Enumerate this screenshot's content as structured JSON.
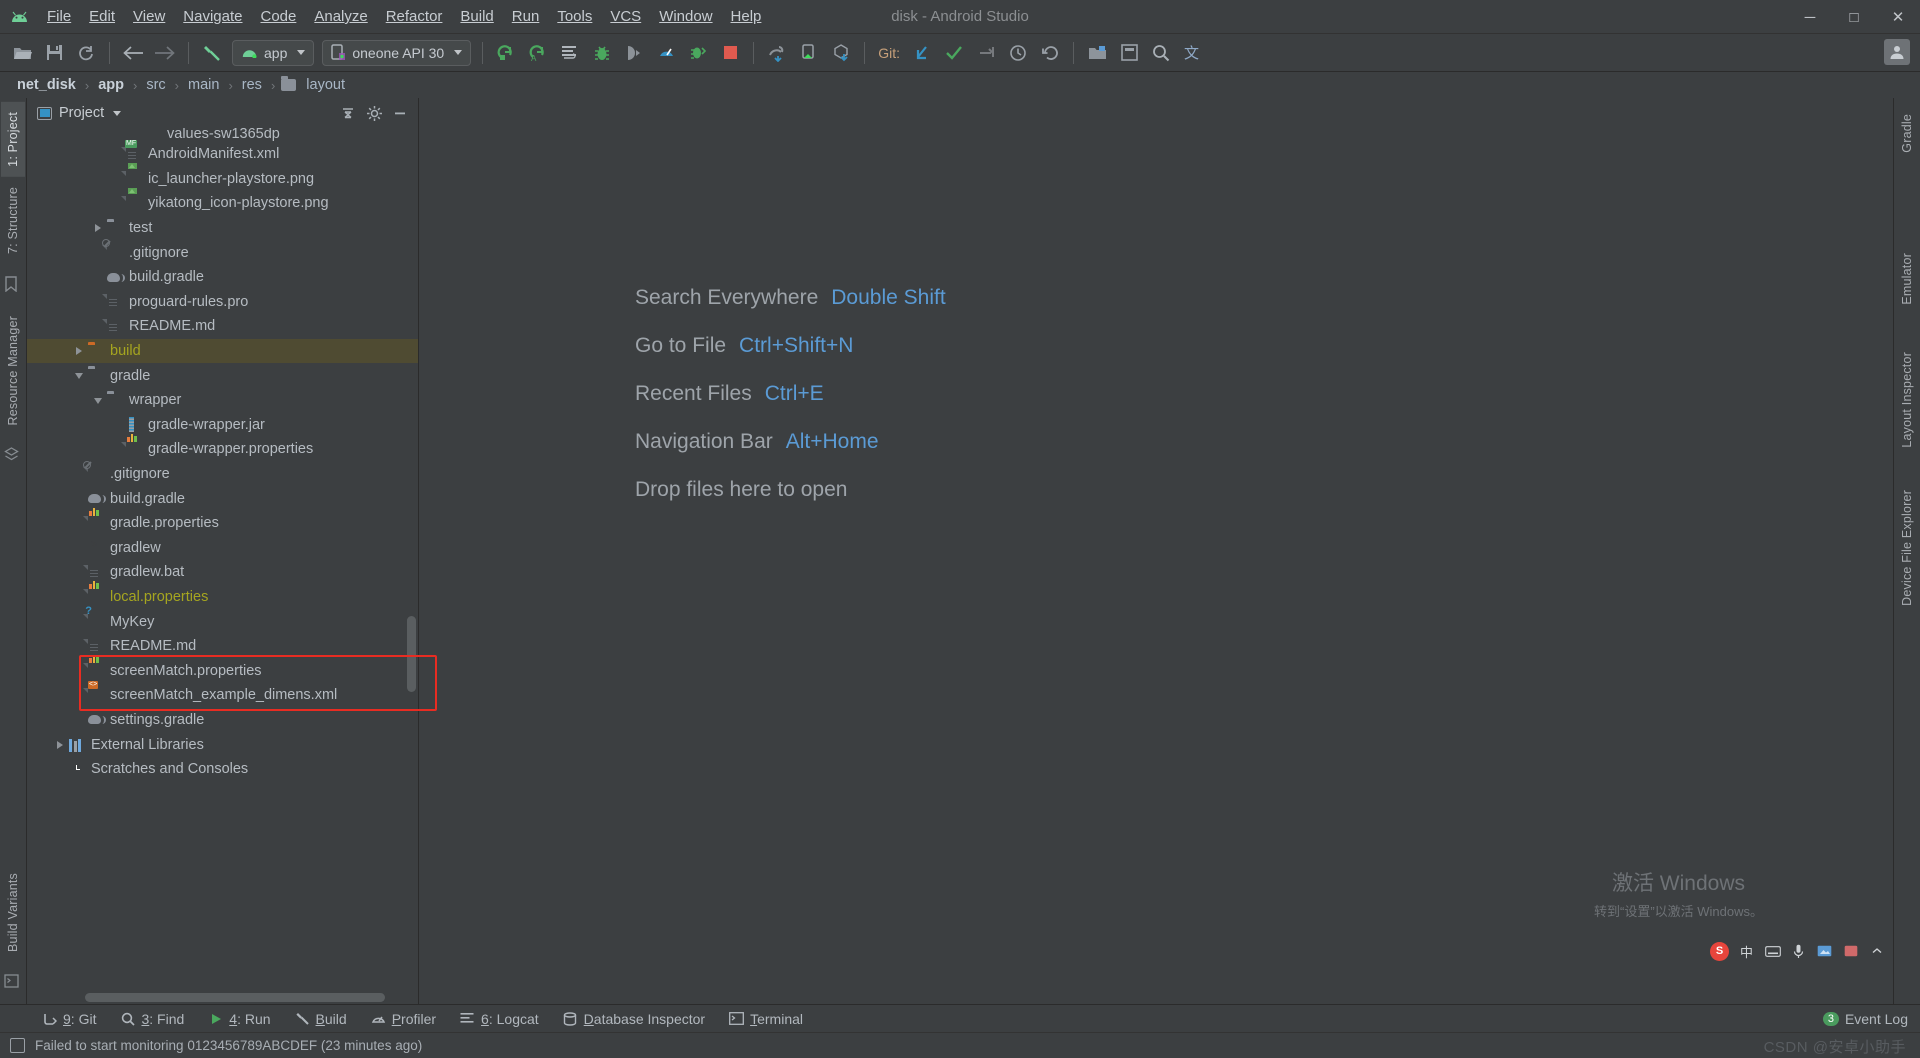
{
  "window": {
    "title": "disk - Android Studio",
    "minimize_label": "─",
    "maximize_label": "□",
    "close_label": "✕"
  },
  "menubar": {
    "logo": "android-logo",
    "items": [
      "File",
      "Edit",
      "View",
      "Navigate",
      "Code",
      "Analyze",
      "Refactor",
      "Build",
      "Run",
      "Tools",
      "VCS",
      "Window",
      "Help"
    ]
  },
  "toolbar": {
    "open_label": "open-folder-icon",
    "save_label": "save-icon",
    "sync_label": "sync-icon",
    "back_label": "back-arrow-icon",
    "forward_label": "forward-arrow-icon",
    "build_hammer_label": "hammer-icon",
    "run_config": "app",
    "device": "oneone API 30",
    "git_label": "Git:",
    "run_label": "run-icon",
    "debug_label": "debug-icon",
    "stop_label": "stop-icon",
    "profiler_label": "profiler-icon"
  },
  "breadcrumb": {
    "items": [
      "net_disk",
      "app",
      "src",
      "main",
      "res",
      "layout"
    ],
    "separator": "›",
    "bold_indices": [
      0,
      1
    ]
  },
  "left_strip": {
    "tabs": [
      "1: Project",
      "7: Structure",
      "Resource Manager",
      "Build Variants"
    ]
  },
  "right_strip": {
    "tabs": [
      "Gradle",
      "Emulator",
      "Layout Inspector",
      "Device File Explorer"
    ]
  },
  "project_panel": {
    "title": "Project",
    "collapse_icon": "collapse-all-icon",
    "settings_icon": "gear-icon",
    "hide_icon": "minimize-icon",
    "tree": [
      {
        "label": "values-sw1365dp",
        "indent": 5,
        "icon": "folder",
        "arrow": "none",
        "clipped": true
      },
      {
        "label": "AndroidManifest.xml",
        "indent": 4,
        "icon": "file-manifest",
        "arrow": "none"
      },
      {
        "label": "ic_launcher-playstore.png",
        "indent": 4,
        "icon": "file-image",
        "arrow": "none"
      },
      {
        "label": "yikatong_icon-playstore.png",
        "indent": 4,
        "icon": "file-image",
        "arrow": "none"
      },
      {
        "label": "test",
        "indent": 3,
        "icon": "folder",
        "arrow": "right"
      },
      {
        "label": ".gitignore",
        "indent": 3,
        "icon": "file-ignored",
        "arrow": "none"
      },
      {
        "label": "build.gradle",
        "indent": 3,
        "icon": "gradle",
        "arrow": "none"
      },
      {
        "label": "proguard-rules.pro",
        "indent": 3,
        "icon": "file-text",
        "arrow": "none"
      },
      {
        "label": "README.md",
        "indent": 3,
        "icon": "file-text",
        "arrow": "none"
      },
      {
        "label": "build",
        "indent": 2,
        "icon": "folder-orange",
        "arrow": "right",
        "highlight": true,
        "color": "olive"
      },
      {
        "label": "gradle",
        "indent": 2,
        "icon": "folder",
        "arrow": "down"
      },
      {
        "label": "wrapper",
        "indent": 3,
        "icon": "folder",
        "arrow": "down"
      },
      {
        "label": "gradle-wrapper.jar",
        "indent": 4,
        "icon": "jar",
        "arrow": "none"
      },
      {
        "label": "gradle-wrapper.properties",
        "indent": 4,
        "icon": "file-properties",
        "arrow": "none"
      },
      {
        "label": ".gitignore",
        "indent": 2,
        "icon": "file-ignored",
        "arrow": "none"
      },
      {
        "label": "build.gradle",
        "indent": 2,
        "icon": "gradle",
        "arrow": "none"
      },
      {
        "label": "gradle.properties",
        "indent": 2,
        "icon": "file-properties",
        "arrow": "none"
      },
      {
        "label": "gradlew",
        "indent": 2,
        "icon": "shell",
        "arrow": "none"
      },
      {
        "label": "gradlew.bat",
        "indent": 2,
        "icon": "file-text",
        "arrow": "none"
      },
      {
        "label": "local.properties",
        "indent": 2,
        "icon": "file-properties",
        "arrow": "none",
        "color": "olive"
      },
      {
        "label": "MyKey",
        "indent": 2,
        "icon": "file-unknown",
        "arrow": "none"
      },
      {
        "label": "README.md",
        "indent": 2,
        "icon": "file-text",
        "arrow": "none"
      },
      {
        "label": "screenMatch.properties",
        "indent": 2,
        "icon": "file-properties",
        "arrow": "none"
      },
      {
        "label": "screenMatch_example_dimens.xml",
        "indent": 2,
        "icon": "file-xml",
        "arrow": "none"
      },
      {
        "label": "settings.gradle",
        "indent": 2,
        "icon": "gradle",
        "arrow": "none"
      },
      {
        "label": "External Libraries",
        "indent": 1,
        "icon": "libraries",
        "arrow": "right"
      },
      {
        "label": "Scratches and Consoles",
        "indent": 1,
        "icon": "scratches",
        "arrow": "none"
      }
    ],
    "annotation_box": "red-highlight-around-screenmatch-files"
  },
  "editor": {
    "hints": [
      {
        "action": "Search Everywhere",
        "shortcut": "Double Shift"
      },
      {
        "action": "Go to File",
        "shortcut": "Ctrl+Shift+N"
      },
      {
        "action": "Recent Files",
        "shortcut": "Ctrl+E"
      },
      {
        "action": "Navigation Bar",
        "shortcut": "Alt+Home"
      },
      {
        "action": "Drop files here to open",
        "shortcut": ""
      }
    ],
    "watermark_line1": "激活 Windows",
    "watermark_line2": "转到“设置”以激活 Windows。"
  },
  "tray": {
    "items": [
      "sogou-icon",
      "lang-cn",
      "keyboard-icon",
      "mic-icon",
      "picture-icon",
      "tray-icon",
      "chevron-icon"
    ],
    "lang_label": "中"
  },
  "bottom_tabs": [
    {
      "label": "9: Git",
      "icon": "git-icon",
      "underline": "9"
    },
    {
      "label": "3: Find",
      "icon": "search-icon",
      "underline": "3"
    },
    {
      "label": "4: Run",
      "icon": "run-icon",
      "underline": "4"
    },
    {
      "label": "Build",
      "icon": "hammer-icon",
      "underline": ""
    },
    {
      "label": "Profiler",
      "icon": "profiler-icon",
      "underline": ""
    },
    {
      "label": "6: Logcat",
      "icon": "logcat-icon",
      "underline": "6"
    },
    {
      "label": "Database Inspector",
      "icon": "database-icon",
      "underline": ""
    },
    {
      "label": "Terminal",
      "icon": "terminal-icon",
      "underline": ""
    }
  ],
  "event_log": {
    "label": "Event Log",
    "count": "3"
  },
  "statusbar": {
    "message": "Failed to start monitoring 0123456789ABCDEF (23 minutes ago)",
    "watermark": "CSDN @安卓小助手"
  },
  "colors": {
    "bg": "#3c3f41",
    "accent_blue": "#5b9bd5",
    "olive": "#a5a520",
    "red_box": "#e82c22",
    "green": "#4a9b5e",
    "orange": "#cc6a26"
  }
}
